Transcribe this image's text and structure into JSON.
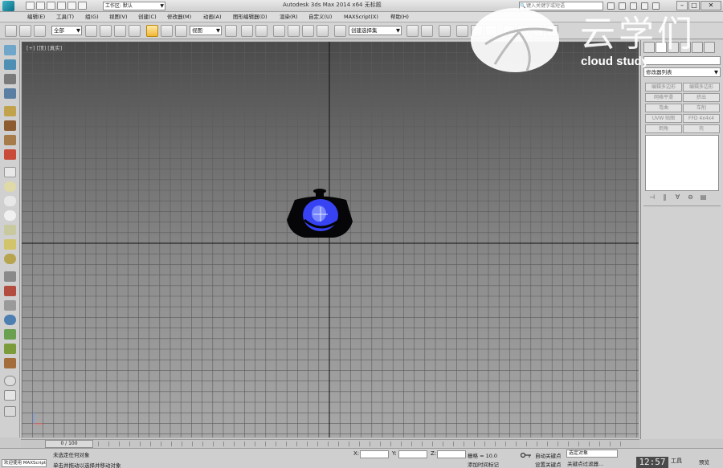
{
  "titlebar": {
    "workspace": "工作区: 默认",
    "window_title": "Autodesk 3ds Max  2014 x64     无标题",
    "search_placeholder": "键入关键字或短语"
  },
  "menus": [
    "编辑(E)",
    "工具(T)",
    "组(G)",
    "视图(V)",
    "创建(C)",
    "修改器(M)",
    "动画(A)",
    "图形编辑器(D)",
    "渲染(R)",
    "自定义(U)",
    "MAXScript(X)",
    "帮助(H)"
  ],
  "toolbar": {
    "selection_filter": "全部",
    "reference_coord": "视图",
    "named_selection": "创建选择集"
  },
  "viewport": {
    "label": "[+] [顶] [真实]"
  },
  "command_panel": {
    "modifier_list": "修改器列表",
    "buttons": [
      [
        "编辑多边形",
        "编辑多边形"
      ],
      [
        "网格平滑",
        "挤出"
      ],
      [
        "弯曲",
        "车削"
      ],
      [
        "UVW 贴图",
        "FFD 4x4x4"
      ],
      [
        "倒角",
        "壳"
      ]
    ]
  },
  "time": {
    "frame_counter": "0 / 100"
  },
  "status": {
    "maxscript_label": "欢迎使用 MAXScript",
    "selection_status": "未选定任何对象",
    "prompt": "单击并拖动以选择并移动对象",
    "x_label": "X:",
    "y_label": "Y:",
    "z_label": "Z:",
    "grid": "栅格 = 10.0",
    "add_time_tag": "添加时间标记",
    "auto_key": "自动关键点",
    "set_key": "设置关键点",
    "key_mode": "选定对象",
    "key_filters": "关键点过滤器..."
  },
  "overlay": {
    "clock": "12:57",
    "tools_label": "工具",
    "preview_label": "预览",
    "watermark_cn": "云学们",
    "watermark_en": "cloud study"
  },
  "colors": {
    "accent_active": "#f2b736",
    "object_glow": "#3a46ff"
  }
}
